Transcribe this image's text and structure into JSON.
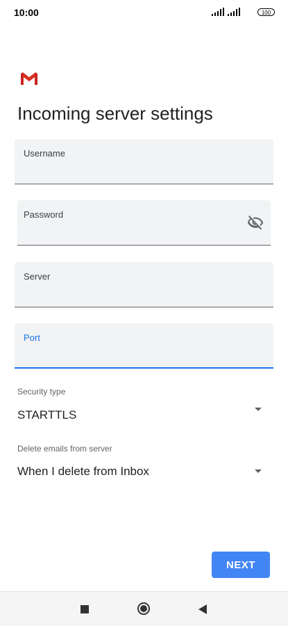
{
  "status_bar": {
    "time": "10:00",
    "battery": "100"
  },
  "app": {
    "logo_icon": "gmail-icon",
    "title": "Incoming server settings"
  },
  "form": {
    "username": {
      "label": "Username",
      "value": ""
    },
    "password": {
      "label": "Password",
      "value": "",
      "toggle_icon": "eye-off-icon"
    },
    "server": {
      "label": "Server",
      "value": ""
    },
    "port": {
      "label": "Port",
      "value": "",
      "focused": true
    }
  },
  "security_type": {
    "label": "Security type",
    "value": "STARTTLS"
  },
  "delete_emails": {
    "label": "Delete emails from server",
    "value": "When I delete from Inbox"
  },
  "actions": {
    "next_label": "NEXT"
  },
  "colors": {
    "accent": "#1a73e8",
    "button": "#4285f4",
    "field_bg": "#f1f3f4",
    "gmail_red": "#d93025"
  },
  "nav": {
    "recents_icon": "square-icon",
    "home_icon": "circle-icon",
    "back_icon": "triangle-back-icon"
  }
}
